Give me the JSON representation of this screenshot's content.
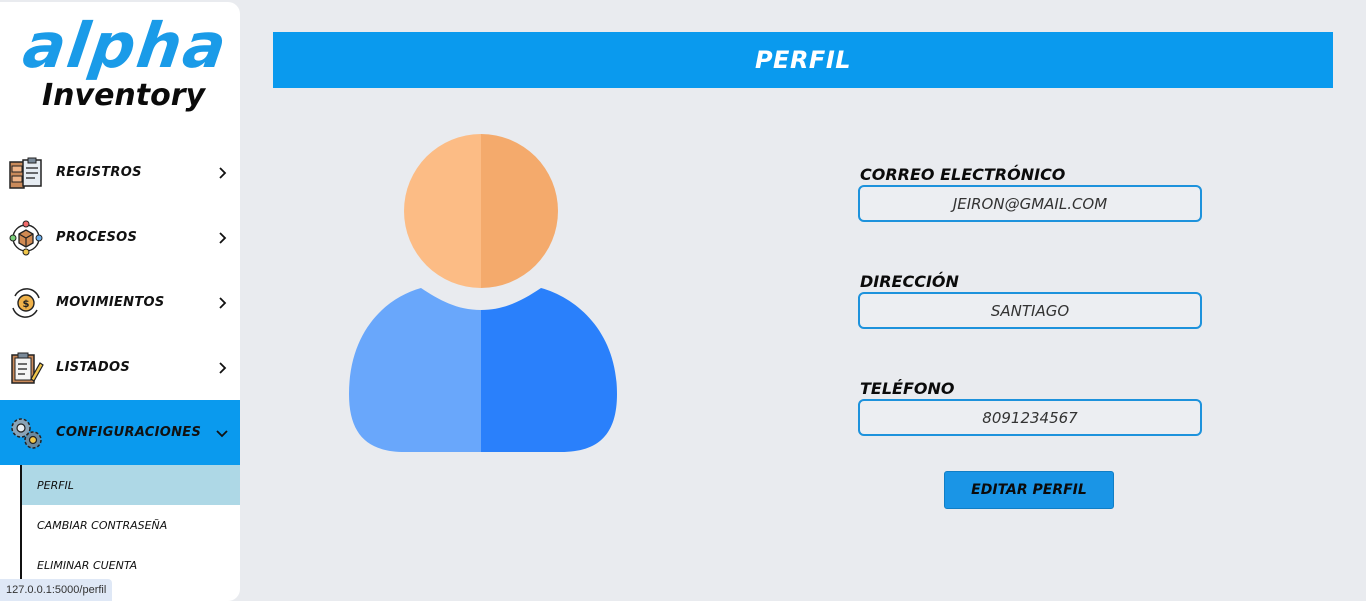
{
  "brand": {
    "name": "alpha",
    "subtitle": "Inventory",
    "accent": "#0a9aee"
  },
  "sidebar": {
    "items": [
      {
        "label": "REGISTROS",
        "icon": "registros-icon"
      },
      {
        "label": "PROCESOS",
        "icon": "procesos-icon"
      },
      {
        "label": "MOVIMIENTOS",
        "icon": "movimientos-icon"
      },
      {
        "label": "LISTADOS",
        "icon": "listados-icon"
      },
      {
        "label": "CONFIGURACIONES",
        "icon": "gears-icon",
        "active": true
      }
    ],
    "submenu": [
      {
        "label": "PERFIL",
        "active": true
      },
      {
        "label": "CAMBIAR CONTRASEÑA"
      },
      {
        "label": "ELIMINAR CUENTA"
      }
    ]
  },
  "status_url": "127.0.0.1:5000/perfil",
  "page": {
    "title": "PERFIL"
  },
  "profile": {
    "email_label": "CORREO ELECTRÓNICO",
    "email_value": "JEIRON@GMAIL.COM",
    "address_label": "DIRECCIÓN",
    "address_value": "SANTIAGO",
    "phone_label": "TELÉFONO",
    "phone_value": "8091234567",
    "edit_button": "EDITAR PERFIL"
  },
  "avatar_icon": "user-avatar-icon"
}
